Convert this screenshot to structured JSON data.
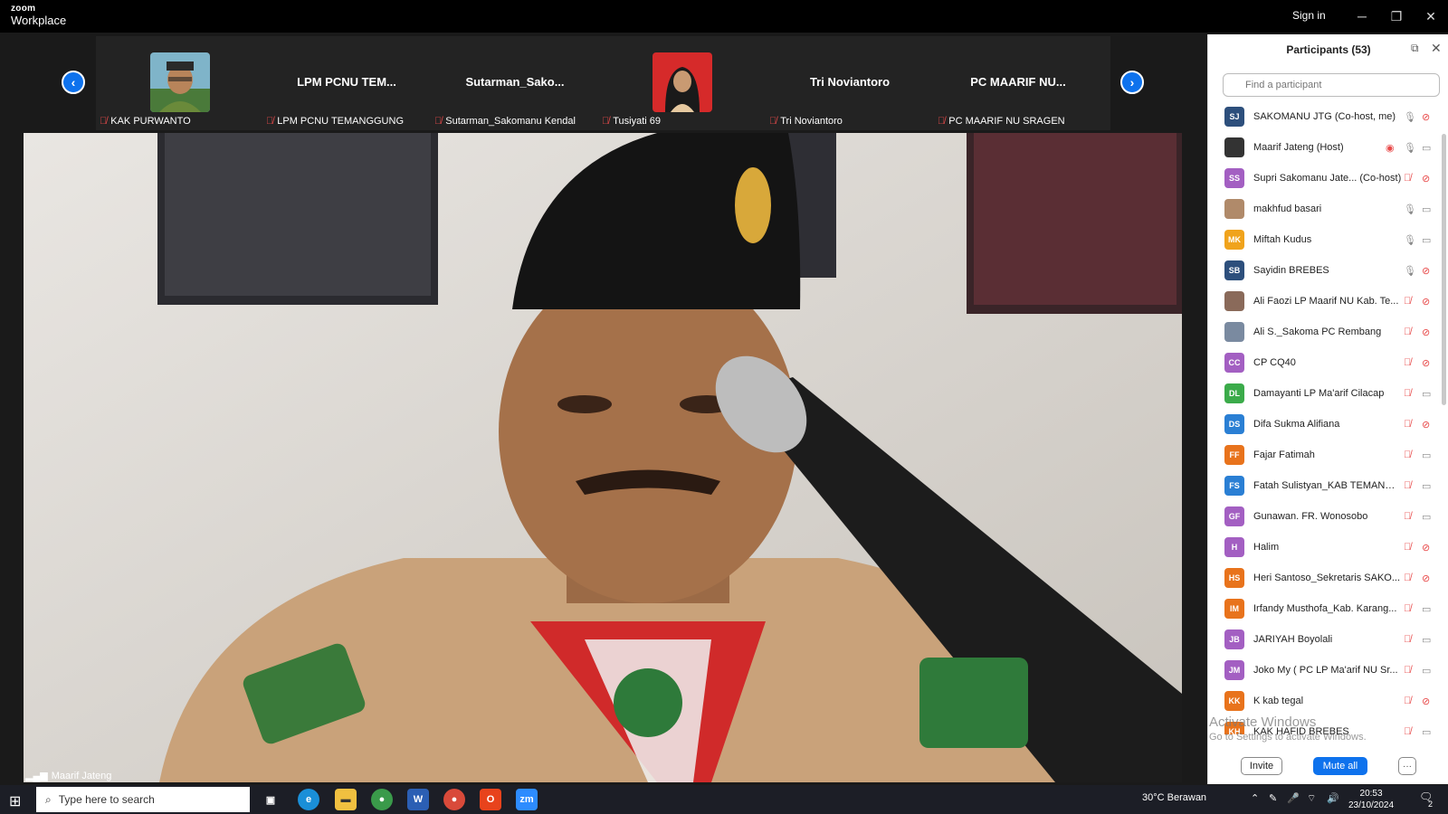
{
  "titlebar": {
    "brand_top": "zoom",
    "brand_bottom": "Workplace",
    "signin": "Sign in",
    "minimize": "─",
    "restore": "❐",
    "close": "✕"
  },
  "gallery": {
    "prev": "‹",
    "next": "›",
    "tiles": [
      {
        "name": "",
        "label": "KAK PURWANTO",
        "has_photo": true
      },
      {
        "name": "LPM PCNU TEM...",
        "label": "LPM PCNU TEMANGGUNG"
      },
      {
        "name": "Sutarman_Sako...",
        "label": "Sutarman_Sakomanu Kendal"
      },
      {
        "name": "",
        "label": "Tusiyati 69",
        "has_photo": true
      },
      {
        "name": "Tri Noviantoro",
        "label": "Tri Noviantoro"
      },
      {
        "name": "PC MAARIF NU...",
        "label": "PC MAARIF NU SRAGEN"
      }
    ]
  },
  "video": {
    "speaker_label": "Maarif Jateng"
  },
  "panel": {
    "title": "Participants (53)",
    "search_placeholder": "Find a participant",
    "participants": [
      {
        "initials": "SJ",
        "color": "#2d4f7c",
        "name": "SAKOMANU JTG (Co-host, me)",
        "mic": "on",
        "cam": "off"
      },
      {
        "initials": "",
        "color": "#333333",
        "name": "Maarif Jateng (Host)",
        "mic": "on",
        "cam": "on",
        "recording": true
      },
      {
        "initials": "SS",
        "color": "#a35fc2",
        "name": "Supri Sakomanu Jate... (Co-host)",
        "mic": "off",
        "cam": "off"
      },
      {
        "initials": "",
        "color": "#b08a6a",
        "name": "makhfud basari",
        "mic": "on",
        "cam": "on"
      },
      {
        "initials": "MK",
        "color": "#f0a31c",
        "name": "Miftah Kudus",
        "mic": "on",
        "cam": "on"
      },
      {
        "initials": "SB",
        "color": "#2d4f7c",
        "name": "Sayidin BREBES",
        "mic": "on",
        "cam": "off"
      },
      {
        "initials": "",
        "color": "#8a6a5a",
        "name": "Ali Faozi LP Maarif NU Kab. Te...",
        "mic": "off",
        "cam": "off"
      },
      {
        "initials": "",
        "color": "#7a8aa0",
        "name": "Ali S._Sakoma PC Rembang",
        "mic": "off",
        "cam": "off"
      },
      {
        "initials": "CC",
        "color": "#a35fc2",
        "name": "CP CQ40",
        "mic": "off",
        "cam": "off"
      },
      {
        "initials": "DL",
        "color": "#3bab4a",
        "name": "Damayanti LP Ma'arif Cilacap",
        "mic": "off",
        "cam": "on"
      },
      {
        "initials": "DS",
        "color": "#2a7fd4",
        "name": "Difa Sukma Alifiana",
        "mic": "off",
        "cam": "off"
      },
      {
        "initials": "FF",
        "color": "#e8731c",
        "name": "Fajar Fatimah",
        "mic": "off",
        "cam": "on"
      },
      {
        "initials": "FS",
        "color": "#2a7fd4",
        "name": "Fatah Sulistyan_KAB TEMANGG...",
        "mic": "off",
        "cam": "on"
      },
      {
        "initials": "GF",
        "color": "#a35fc2",
        "name": "Gunawan. FR. Wonosobo",
        "mic": "off",
        "cam": "on"
      },
      {
        "initials": "H",
        "color": "#a35fc2",
        "name": "Halim",
        "mic": "off",
        "cam": "off"
      },
      {
        "initials": "HS",
        "color": "#e8731c",
        "name": "Heri Santoso_Sekretaris SAKO...",
        "mic": "off",
        "cam": "off"
      },
      {
        "initials": "IM",
        "color": "#e8731c",
        "name": "Irfandy Musthofa_Kab. Karang...",
        "mic": "off",
        "cam": "on"
      },
      {
        "initials": "JB",
        "color": "#a35fc2",
        "name": "JARIYAH Boyolali",
        "mic": "off",
        "cam": "on"
      },
      {
        "initials": "JM",
        "color": "#a35fc2",
        "name": "Joko My ( PC LP Ma'arif NU Sr...",
        "mic": "off",
        "cam": "on"
      },
      {
        "initials": "KK",
        "color": "#e8731c",
        "name": "K kab tegal",
        "mic": "off",
        "cam": "off"
      },
      {
        "initials": "KH",
        "color": "#e8731c",
        "name": "KAK HAFID BREBES",
        "mic": "off",
        "cam": "on"
      }
    ],
    "invite": "Invite",
    "mute_all": "Mute all",
    "more": "···"
  },
  "watermark": {
    "line1": "Activate Windows",
    "line2": "Go to Settings to activate Windows."
  },
  "taskbar": {
    "search_placeholder": "Type here to search",
    "weather": "30°C  Berawan",
    "time": "20:53",
    "date": "23/10/2024",
    "notif_count": "2"
  }
}
